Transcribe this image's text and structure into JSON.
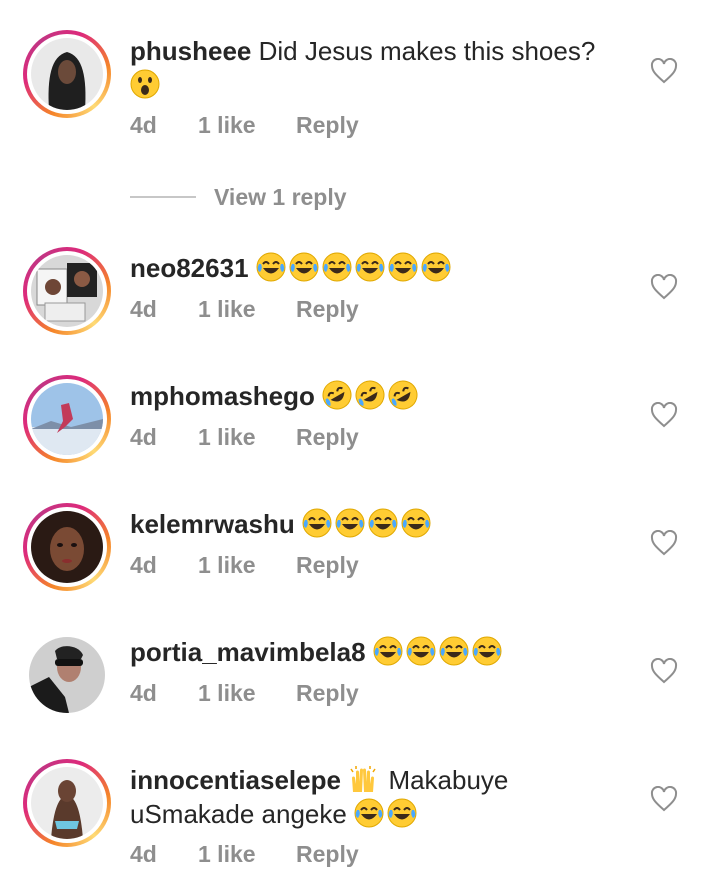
{
  "comments": [
    {
      "username": "phusheee",
      "text": "Did Jesus makes this shoes?",
      "emojis": [
        "astonished"
      ],
      "time": "4d",
      "likes": "1 like",
      "reply": "Reply"
    },
    {
      "username": "neo82631",
      "text": "",
      "emojis": [
        "joy",
        "joy",
        "joy",
        "joy",
        "joy",
        "joy"
      ],
      "time": "4d",
      "likes": "1 like",
      "reply": "Reply"
    },
    {
      "username": "mphomashego",
      "text": "",
      "emojis": [
        "rofl",
        "rofl",
        "rofl"
      ],
      "time": "4d",
      "likes": "1 like",
      "reply": "Reply"
    },
    {
      "username": "kelemrwashu",
      "text": "",
      "emojis": [
        "joy",
        "joy",
        "joy",
        "joy"
      ],
      "time": "4d",
      "likes": "1 like",
      "reply": "Reply"
    },
    {
      "username": "portia_mavimbela8",
      "text": "",
      "emojis": [
        "joy",
        "joy",
        "joy",
        "joy"
      ],
      "time": "4d",
      "likes": "1 like",
      "reply": "Reply"
    },
    {
      "username": "innocentiaselepe",
      "text_before": "",
      "raised_hands": "raised-hands",
      "text_after": "Makabuye uSmakade angeke",
      "emojis": [
        "joy",
        "joy"
      ],
      "time": "4d",
      "likes": "1 like",
      "reply": "Reply"
    }
  ],
  "view_replies": "View 1 reply",
  "colors": {
    "text": "#262626",
    "meta": "#8e8e8e",
    "ring_start": "#f58529",
    "ring_end": "#dd2a7b"
  }
}
